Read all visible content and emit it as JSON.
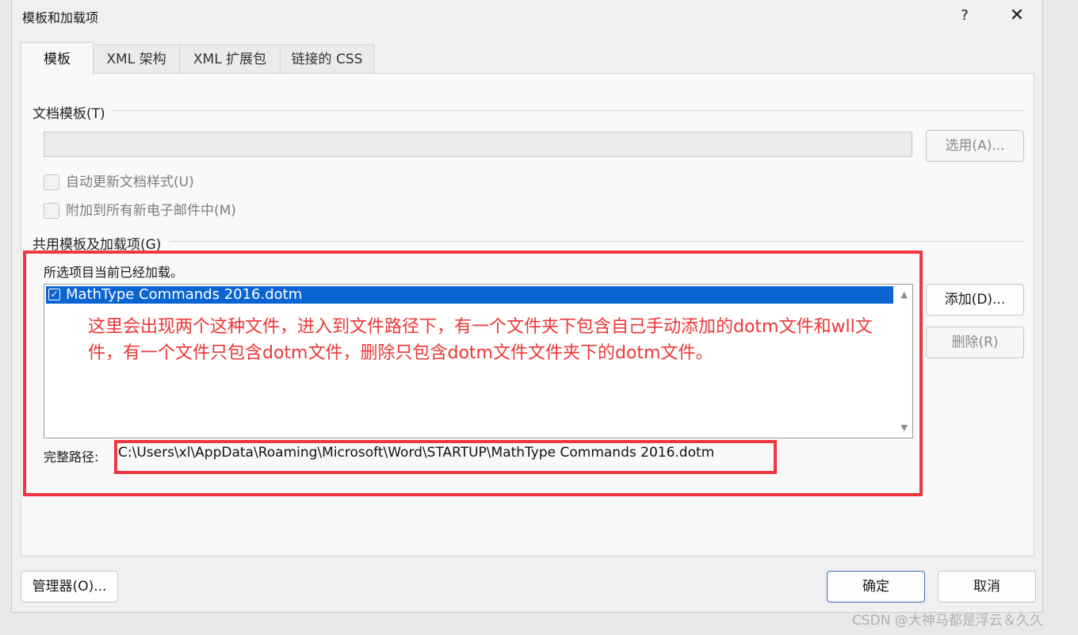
{
  "dialog": {
    "title": "模板和加载项",
    "help_label": "?",
    "close_label": "✕"
  },
  "tabs": [
    {
      "label": "模板",
      "active": true
    },
    {
      "label": "XML 架构",
      "active": false
    },
    {
      "label": "XML 扩展包",
      "active": false
    },
    {
      "label": "链接的 CSS",
      "active": false
    }
  ],
  "document_template": {
    "group_label": "文档模板(T)",
    "path_value": "",
    "select_button": "选用(A)...",
    "auto_update_label": "自动更新文档样式(U)",
    "attach_all_label": "附加到所有新电子邮件中(M)"
  },
  "global_templates": {
    "group_label": "共用模板及加载项(G)",
    "loaded_note": "所选项目当前已经加载。",
    "items": [
      {
        "label": "MathType Commands 2016.dotm",
        "checked": true,
        "selected": true
      }
    ],
    "add_button": "添加(D)...",
    "remove_button": "删除(R)",
    "full_path_label": "完整路径:",
    "full_path_value": "C:\\Users\\xl\\AppData\\Roaming\\Microsoft\\Word\\STARTUP\\MathType Commands 2016.dotm"
  },
  "footer": {
    "organizer_button": "管理器(O)...",
    "ok_button": "确定",
    "cancel_button": "取消"
  },
  "annotation": {
    "text": "这里会出现两个这种文件，进入到文件路径下，有一个文件夹下包含自己手动添加的dotm文件和wll文件，有一个文件只包含dotm文件，删除只包含dotm文件文件夹下的dotm文件。",
    "color": "#ee3636"
  },
  "watermark": "CSDN @大神马都是浮云＆久久",
  "colors": {
    "selection": "#0a64d2",
    "annotation_border": "#f0373f"
  }
}
